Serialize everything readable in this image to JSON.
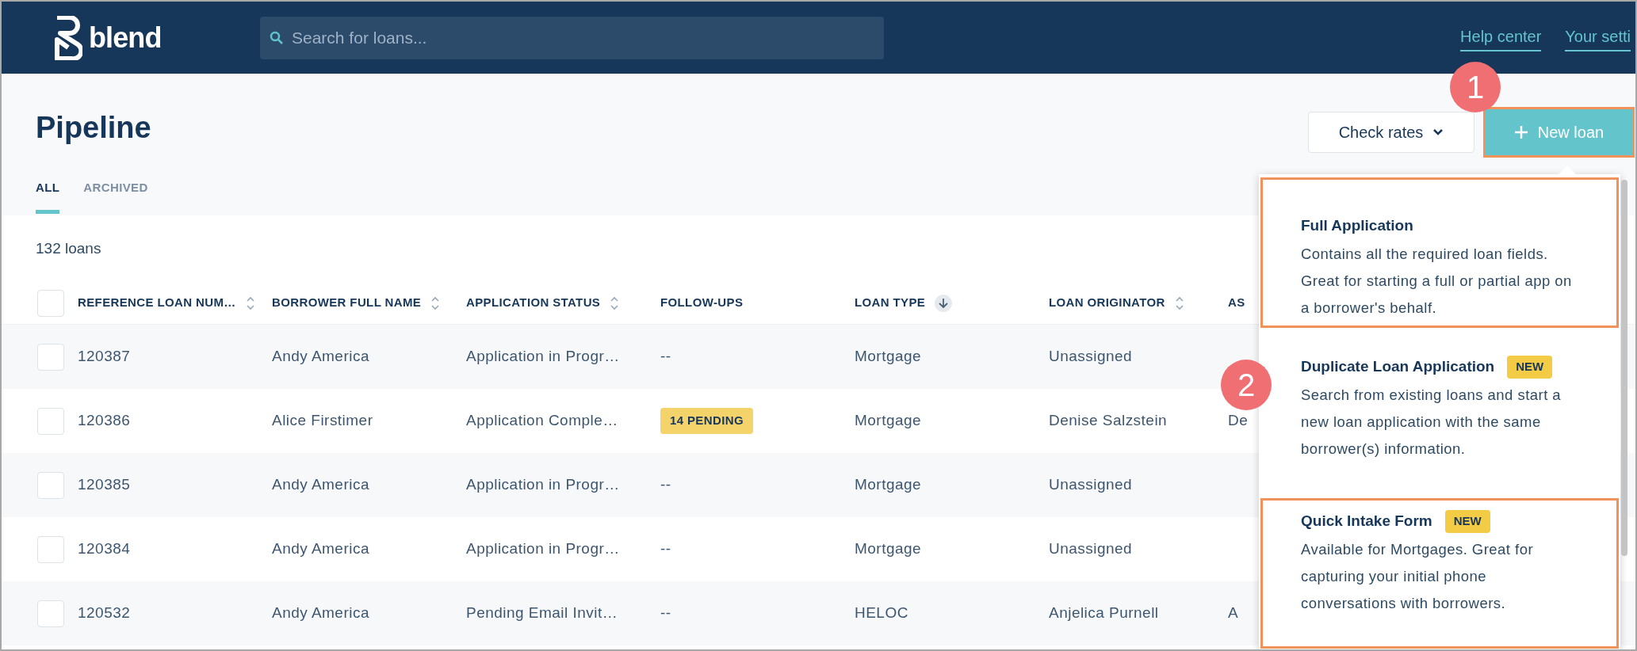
{
  "header": {
    "logo": "blend",
    "search": {
      "placeholder": "Search for loans..."
    },
    "links": [
      "Help center",
      "Your setti"
    ]
  },
  "page": {
    "title": "Pipeline",
    "tabs": [
      {
        "label": "ALL",
        "selected": true
      },
      {
        "label": "ARCHIVED",
        "selected": false
      }
    ],
    "check_rates": "Check rates",
    "new_loan": {
      "label": "New loan",
      "highlighted": true
    }
  },
  "count": "132 loans",
  "table": {
    "select_all": {
      "checked": false
    },
    "columns": [
      {
        "label": "REFERENCE LOAN NUM…",
        "sortable": true,
        "sorted": false
      },
      {
        "label": "BORROWER FULL NAME",
        "sortable": true,
        "sorted": false
      },
      {
        "label": "APPLICATION STATUS",
        "sortable": true,
        "sorted": false
      },
      {
        "label": "FOLLOW-UPS",
        "sortable": false
      },
      {
        "label": "LOAN TYPE",
        "sortable": true,
        "sorted": true
      },
      {
        "label": "LOAN ORIGINATOR",
        "sortable": true,
        "sorted": false
      },
      {
        "label": "AS",
        "sortable": false
      }
    ],
    "rows": [
      {
        "checked": false,
        "cells": [
          "120387",
          "Andy America",
          "Application in Progr…",
          "--",
          "Mortgage",
          "Unassigned",
          null
        ]
      },
      {
        "checked": false,
        "cells": [
          "120386",
          "Alice Firstimer",
          "Application Comple…",
          {
            "badge": "14 PENDING"
          },
          "Mortgage",
          "Denise Salzstein",
          "De"
        ]
      },
      {
        "checked": false,
        "cells": [
          "120385",
          "Andy America",
          "Application in Progr…",
          "--",
          "Mortgage",
          "Unassigned",
          null
        ]
      },
      {
        "checked": false,
        "cells": [
          "120384",
          "Andy America",
          "Application in Progr…",
          "--",
          "Mortgage",
          "Unassigned",
          null
        ]
      },
      {
        "checked": false,
        "cells": [
          "120532",
          "Andy America",
          "Pending Email Invit…",
          "--",
          "HELOC",
          "Anjelica Purnell",
          "A"
        ]
      }
    ]
  },
  "menu": {
    "items": [
      {
        "title": "Full Application",
        "description": "Contains all the required loan fields. Great for starting a full or partial app on a borrower's behalf.",
        "highlighted": true
      },
      {
        "title": "Duplicate Loan Application",
        "badge": "NEW",
        "description": "Search from existing loans and start a new loan application with the same borrower(s) information.",
        "highlighted": false
      },
      {
        "title": "Quick Intake Form",
        "badge": "NEW",
        "description": "Available for Mortgages. Great for capturing your initial phone conversations with borrowers.",
        "highlighted": true
      }
    ]
  },
  "annotations": [
    {
      "label": "1"
    },
    {
      "label": "2"
    }
  ]
}
